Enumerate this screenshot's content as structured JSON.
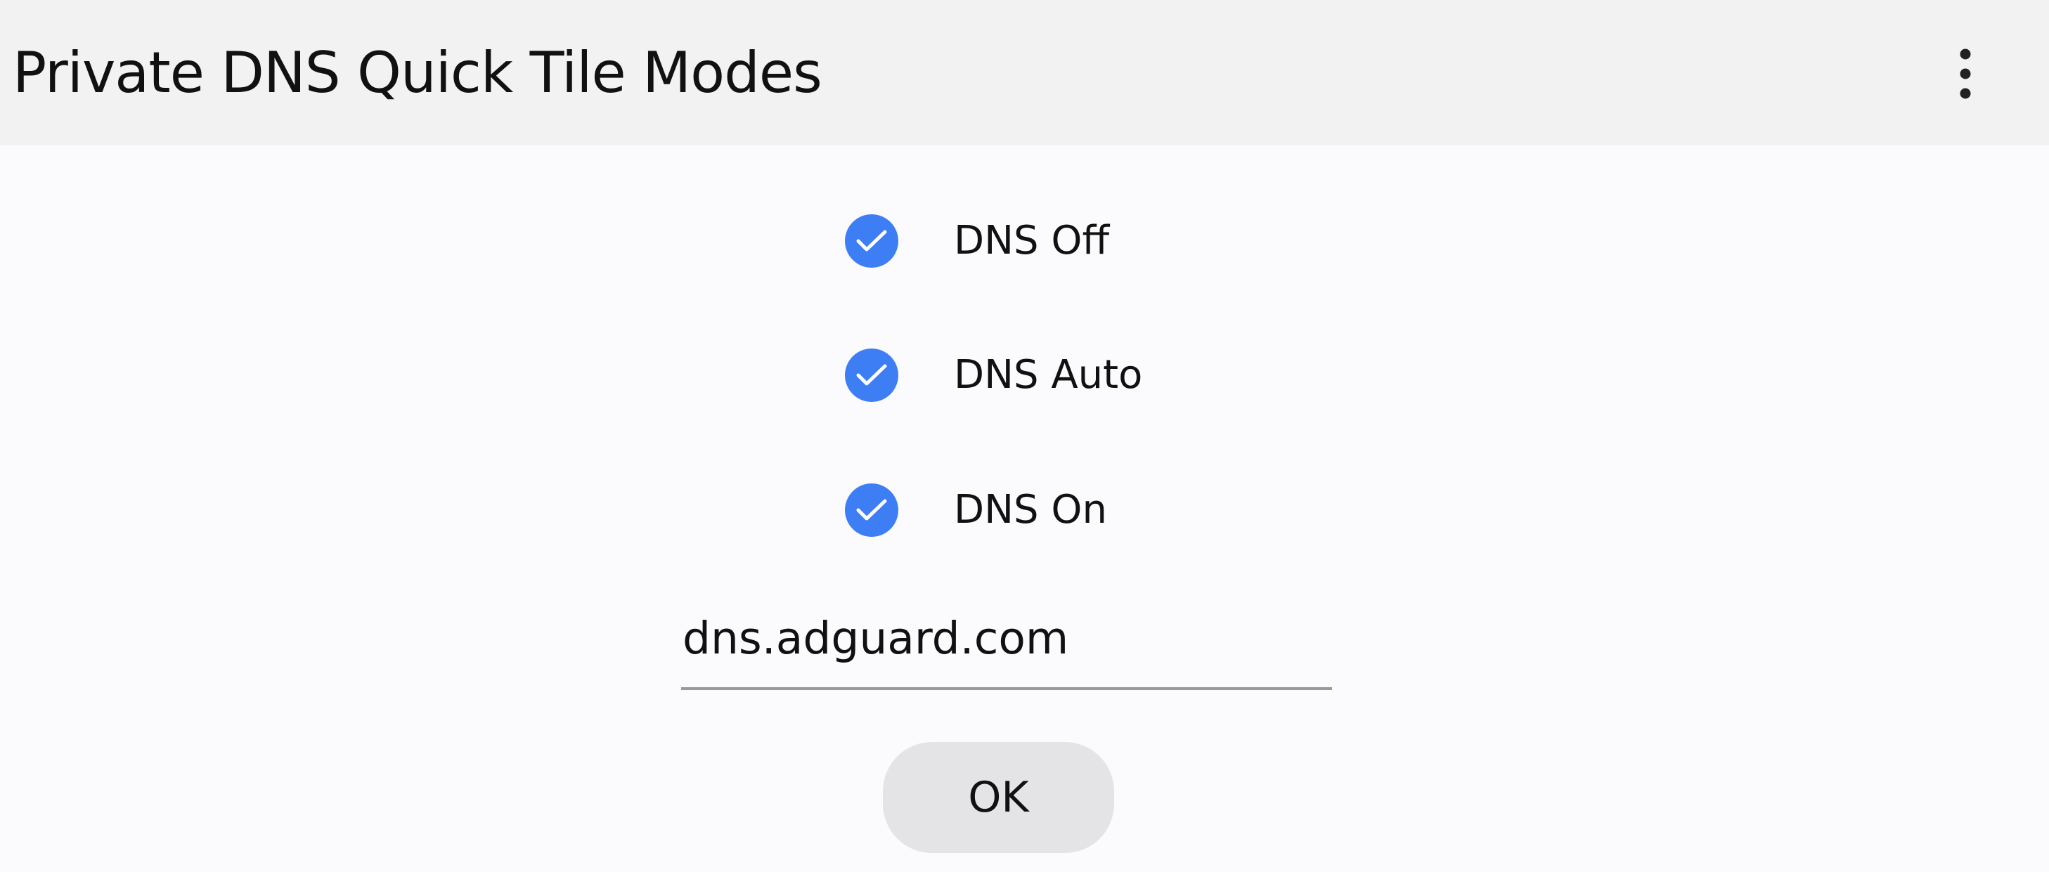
{
  "app_bar": {
    "title": "Private DNS Quick Tile Modes",
    "overflow_icon": "more-vert-icon"
  },
  "dialog": {
    "modes": [
      {
        "label": "DNS Off",
        "checked": true
      },
      {
        "label": "DNS Auto",
        "checked": true
      },
      {
        "label": "DNS On",
        "checked": true
      }
    ],
    "hostname_field": {
      "value": "dns.adguard.com"
    },
    "ok_label": "OK"
  },
  "colors": {
    "accent": "#3e7ef5",
    "app_bar_background": "#f2f2f3",
    "page_background": "#fbfbfd",
    "button_background": "#e4e4e6",
    "underline": "#9a9a9a"
  }
}
